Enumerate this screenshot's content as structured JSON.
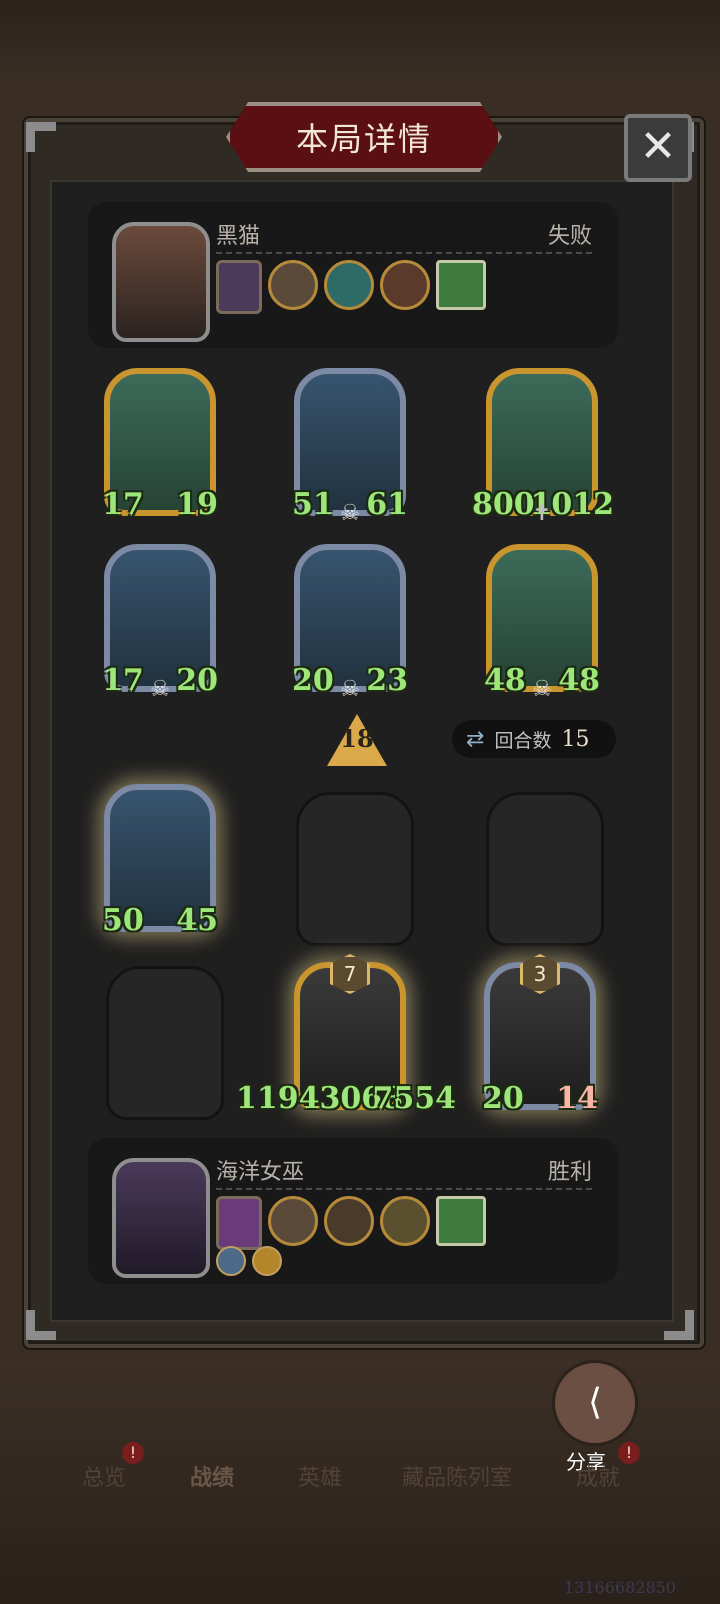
{
  "header": {
    "title": "本局详情",
    "close_label": "✕"
  },
  "opponent": {
    "name": "黑猫",
    "result": "失败",
    "board": [
      {
        "attack": "17",
        "health": "19",
        "skull": false
      },
      {
        "attack": "51",
        "health": "61",
        "skull": true
      },
      {
        "attack": "800",
        "health": "1012",
        "skull": false
      },
      {
        "attack": "17",
        "health": "20",
        "skull": true
      },
      {
        "attack": "20",
        "health": "23",
        "skull": true
      },
      {
        "attack": "48",
        "health": "48",
        "skull": true
      }
    ]
  },
  "marker_value": "18",
  "rounds": {
    "label": "回合数",
    "value": "15"
  },
  "player": {
    "name": "海洋女巫",
    "result": "胜利",
    "board": [
      {
        "attack": "50",
        "health": "45"
      },
      {
        "attack": "11943068",
        "health": "7554",
        "level": "7"
      },
      {
        "attack": "20",
        "health": "14",
        "level": "3"
      }
    ]
  },
  "share": {
    "label": "分享",
    "icon": "share-icon"
  },
  "tabs": [
    {
      "label": "总览",
      "notification": "!"
    },
    {
      "label": "战绩"
    },
    {
      "label": "英雄"
    },
    {
      "label": "藏品陈列室"
    },
    {
      "label": "成就",
      "notification": "!"
    }
  ],
  "footer_number": "13166682850",
  "colors": {
    "stat_green": "#9ee67a",
    "gold_border": "#c8952e",
    "banner_red": "#5a1012"
  }
}
